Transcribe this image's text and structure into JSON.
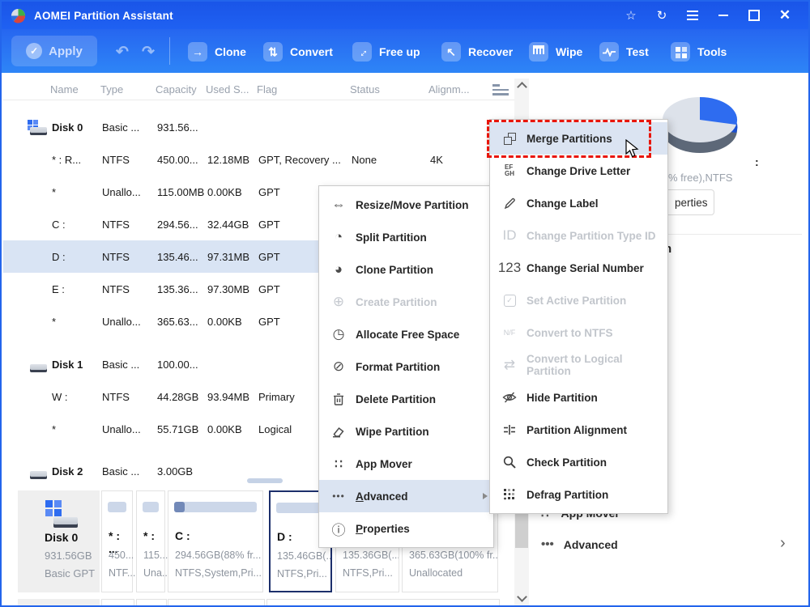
{
  "colors": {
    "titlebar": "#1c5ae9",
    "toolbar_top": "#2666f0",
    "toolbar_bottom": "#2e85f7",
    "selection_row": "#d9e4f4",
    "menu_highlight": "#dbe4f2",
    "red_dashed": "#e8150a",
    "accent_blue": "#2e6cf0"
  },
  "titlebar": {
    "app_name": "AOMEI Partition Assistant",
    "star_glyph": "☆",
    "sync_glyph": "↻"
  },
  "toolbar": {
    "apply_label": "Apply",
    "apply_check_glyph": "✓",
    "undo_glyph": "↶",
    "redo_glyph": "↷",
    "buttons": [
      {
        "label": "Clone",
        "icon": "clone-icon",
        "glyph": "→"
      },
      {
        "label": "Convert",
        "icon": "convert-icon",
        "glyph": "⇅"
      },
      {
        "label": "Free up",
        "icon": "free-up-icon",
        "glyph": "↔"
      },
      {
        "label": "Recover",
        "icon": "recover-icon",
        "glyph": "↖"
      },
      {
        "label": "Wipe",
        "icon": "wipe-shredder-icon",
        "glyph": ""
      },
      {
        "label": "Test",
        "icon": "test-pulse-icon",
        "glyph": ""
      },
      {
        "label": "Tools",
        "icon": "tools-grid-icon",
        "glyph": ""
      }
    ]
  },
  "table": {
    "columns": [
      "Name",
      "Type",
      "Capacity",
      "Used S...",
      "Flag",
      "Status",
      "Alignm..."
    ],
    "rows": [
      {
        "kind": "disk",
        "name": "Disk 0",
        "type": "Basic ...",
        "capacity": "931.56..."
      },
      {
        "kind": "part",
        "name": "* : R...",
        "type": "NTFS",
        "capacity": "450.00...",
        "used": "12.18MB",
        "flag": "GPT, Recovery ...",
        "status": "None",
        "align": "4K"
      },
      {
        "kind": "part",
        "name": "*",
        "type": "Unallo...",
        "capacity": "115.00MB",
        "used": "0.00KB",
        "flag": "GPT"
      },
      {
        "kind": "part",
        "name": "C :",
        "type": "NTFS",
        "capacity": "294.56...",
        "used": "32.44GB",
        "flag": "GPT"
      },
      {
        "kind": "part",
        "name": "D :",
        "type": "NTFS",
        "capacity": "135.46...",
        "used": "97.31MB",
        "flag": "GPT",
        "selected": true
      },
      {
        "kind": "part",
        "name": "E :",
        "type": "NTFS",
        "capacity": "135.36...",
        "used": "97.30MB",
        "flag": "GPT"
      },
      {
        "kind": "part",
        "name": "*",
        "type": "Unallo...",
        "capacity": "365.63...",
        "used": "0.00KB",
        "flag": "GPT"
      },
      {
        "kind": "disk",
        "name": "Disk 1",
        "type": "Basic ...",
        "capacity": "100.00..."
      },
      {
        "kind": "part",
        "name": "W :",
        "type": "NTFS",
        "capacity": "44.28GB",
        "used": "93.94MB",
        "flag": "Primary"
      },
      {
        "kind": "part",
        "name": "*",
        "type": "Unallo...",
        "capacity": "55.71GB",
        "used": "0.00KB",
        "flag": "Logical"
      },
      {
        "kind": "disk",
        "name": "Disk 2",
        "type": "Basic ...",
        "capacity": "3.00GB"
      }
    ]
  },
  "context_menu": {
    "items": [
      {
        "label": "Resize/Move Partition",
        "icon": "resize-move-icon",
        "glyph": "⇔"
      },
      {
        "label": "Split Partition",
        "icon": "split-partition-icon",
        "glyph": "◔"
      },
      {
        "label": "Clone Partition",
        "icon": "clone-partition-icon",
        "glyph": "◕"
      },
      {
        "label": "Create Partition",
        "icon": "create-partition-icon",
        "glyph": "⊕",
        "disabled": true
      },
      {
        "label": "Allocate Free Space",
        "icon": "allocate-free-space-icon",
        "glyph": "◷"
      },
      {
        "label": "Format Partition",
        "icon": "format-partition-icon",
        "glyph": "⊘"
      },
      {
        "label": "Delete Partition",
        "icon": "trash-icon"
      },
      {
        "label": "Wipe Partition",
        "icon": "eraser-icon"
      },
      {
        "label": "App Mover",
        "icon": "app-mover-icon",
        "glyph": "∷"
      },
      {
        "label_prefix": "A",
        "label_rest": "dvanced",
        "icon": "ellipsis-icon",
        "glyph": "•••",
        "highlighted": true,
        "has_submenu": true
      },
      {
        "label_prefix": "P",
        "label_rest": "roperties",
        "icon": "info-icon",
        "glyph": "ⓘ"
      }
    ]
  },
  "submenu": {
    "items": [
      {
        "label": "Merge Partitions",
        "icon": "merge-partitions-icon",
        "highlighted": true,
        "red_dashed": true
      },
      {
        "label": "Change Drive Letter",
        "icon": "drive-letter-icon",
        "icon_top": "EF",
        "icon_bottom": "GH"
      },
      {
        "label": "Change Label",
        "icon": "pencil-icon"
      },
      {
        "label": "Change Partition Type ID",
        "icon": "type-id-icon",
        "glyph": "ID",
        "disabled": true
      },
      {
        "label": "Change Serial Number",
        "icon": "serial-number-icon",
        "glyph": "123"
      },
      {
        "label": "Set Active Partition",
        "icon": "set-active-icon",
        "glyph": "✓",
        "disabled": true
      },
      {
        "label": "Convert to NTFS",
        "icon": "convert-ntfs-icon",
        "glyph": "N/F",
        "disabled": true
      },
      {
        "label": "Convert to Logical Partition",
        "icon": "convert-logical-icon",
        "glyph": "⇄",
        "disabled": true
      },
      {
        "label": "Hide Partition",
        "icon": "eye-slash-icon"
      },
      {
        "label": "Partition Alignment",
        "icon": "alignment-icon"
      },
      {
        "label": "Check Partition",
        "icon": "magnifier-icon"
      },
      {
        "label": "Defrag Partition",
        "icon": "defrag-icon"
      }
    ]
  },
  "sidebar": {
    "fragment_colon": ":",
    "fragment_free": "% free),NTFS",
    "properties_fragment": "perties",
    "fragment_n": "n",
    "app_mover_label": "App Mover",
    "app_mover_glyph": "∷",
    "advanced_label": "Advanced",
    "advanced_glyph": "•••",
    "advanced_chevron": "›"
  },
  "disk_panel": {
    "disk": {
      "name": "Disk 0",
      "size": "931.56GB",
      "layout": "Basic GPT"
    },
    "partitions": [
      {
        "label": "* : ...",
        "size": "450...",
        "fs": "NTF..."
      },
      {
        "label": "* :",
        "size": "115....",
        "fs": "Una..."
      },
      {
        "label": "C :",
        "size": "294.56GB(88% fr...",
        "fs": "NTFS,System,Pri...",
        "used_fraction": 0.13
      },
      {
        "label": "D :",
        "size": "135.46GB(...",
        "fs": "NTFS,Pri...",
        "selected": true
      },
      {
        "label": "",
        "size": "135.36GB(...",
        "fs": "NTFS,Pri..."
      },
      {
        "label": "",
        "size": "365.63GB(100% fr...",
        "fs": "Unallocated"
      }
    ]
  }
}
